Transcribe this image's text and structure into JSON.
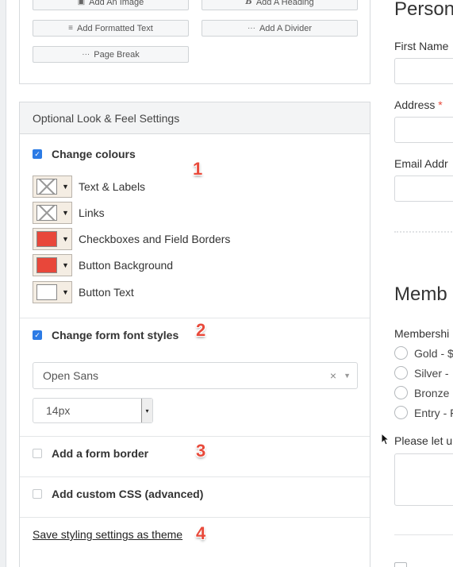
{
  "add_panel": {
    "buttons": [
      {
        "label": "Add An Image",
        "icon": "image-icon",
        "glyph": "▣"
      },
      {
        "label": "Add A Heading",
        "icon": "heading-icon",
        "glyph": "B"
      },
      {
        "label": "Add Formatted Text",
        "icon": "formatted-text-icon",
        "glyph": "≡"
      },
      {
        "label": "Add A Divider",
        "icon": "divider-icon",
        "glyph": "···"
      },
      {
        "label": "Page Break",
        "icon": "page-break-icon",
        "glyph": "···"
      }
    ]
  },
  "look_feel": {
    "title": "Optional Look & Feel Settings",
    "change_colours": {
      "label": "Change colours",
      "checked": true,
      "step": "1",
      "swatches": [
        {
          "label": "Text & Labels",
          "color": "none"
        },
        {
          "label": "Links",
          "color": "none"
        },
        {
          "label": "Checkboxes and Field Borders",
          "color": "#e8473a"
        },
        {
          "label": "Button Background",
          "color": "#e8473a"
        },
        {
          "label": "Button Text",
          "color": "#ffffff"
        }
      ]
    },
    "change_fonts": {
      "label": "Change form font styles",
      "checked": true,
      "step": "2",
      "font_family": "Open Sans",
      "font_size": "14px"
    },
    "form_border": {
      "label": "Add a form border",
      "checked": false,
      "step": "3"
    },
    "custom_css": {
      "label": "Add custom CSS (advanced)",
      "checked": false
    },
    "save_theme": {
      "label": "Save styling settings as theme",
      "step": "4"
    }
  },
  "preview": {
    "heading1": "Person",
    "first_name_label": "First Name",
    "address_label": "Address",
    "address_required": "*",
    "email_label": "Email Addr",
    "heading2": "Memb",
    "membership_label": "Membershi",
    "options": [
      "Gold - $",
      "Silver - ",
      "Bronze",
      "Entry - F"
    ],
    "please_label": "Please let u"
  },
  "colors": {
    "accent": "#2c7be5",
    "step_number": "#e84a3b"
  }
}
